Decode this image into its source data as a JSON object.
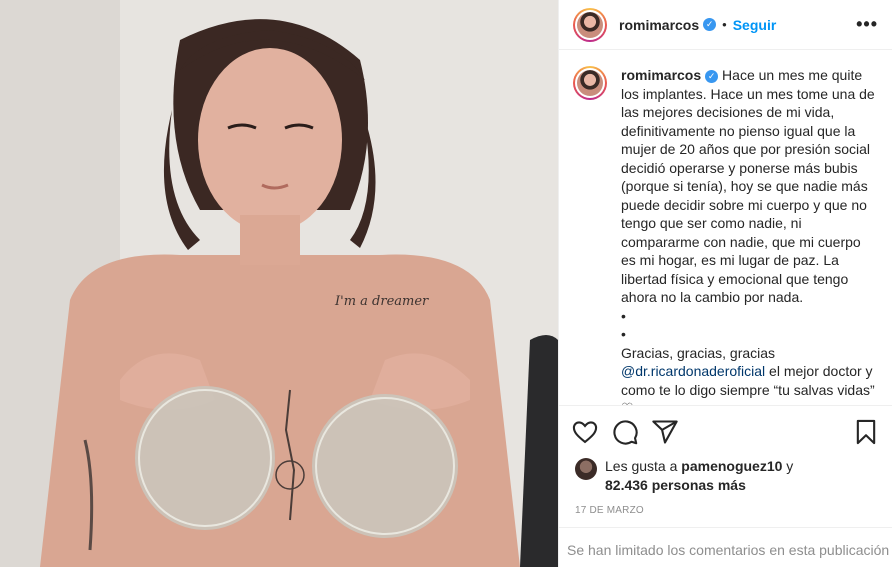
{
  "post": {
    "username": "romimarcos",
    "follow_label": "Seguir",
    "separator": "•",
    "more_label": "•••",
    "caption": "Hace un mes me quite los implantes. Hace un mes tome una de las mejores decisiones de mi vida, definitivamente no pienso igual que la mujer de 20 años que por presión social decidió operarse y ponerse más bubis (porque si tenía), hoy se que nadie más puede decidir sobre mi cuerpo y que no tengo que ser como nadie, ni compararme con nadie, que mi cuerpo es mi hogar, es mi lugar de paz. La libertad física y emocional que tengo ahora no la cambio por nada.\n•\n•\nGracias, gracias, gracias ",
    "mention": "@dr.ricardonaderoficial",
    "caption_end": " el mejor doctor y como te lo digo siempre “tu salvas vidas” ♡",
    "likes": {
      "prefix": "Les gusta a ",
      "user": "pamenoguez10",
      "conjunction": " y",
      "count_text": "82.436 personas más"
    },
    "date": "17 DE MARZO",
    "comments_notice": "Se han limitado los comentarios en esta publicación"
  },
  "image": {
    "tattoo_text": "I'm a dreamer"
  },
  "colors": {
    "accent": "#0095f6",
    "verified": "#3897f0",
    "mention": "#00376b",
    "muted": "#8e8e8e"
  }
}
